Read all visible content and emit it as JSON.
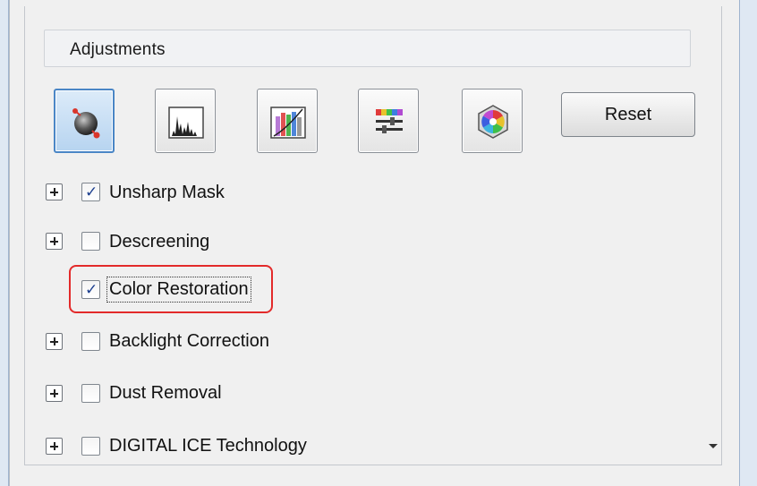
{
  "panel": {
    "title": "Adjustments"
  },
  "toolbar": {
    "buttons": [
      {
        "icon": "auto-exposure-icon",
        "active": true
      },
      {
        "icon": "histogram-icon",
        "active": false
      },
      {
        "icon": "tone-curve-icon",
        "active": false
      },
      {
        "icon": "color-balance-icon",
        "active": false
      },
      {
        "icon": "color-palette-icon",
        "active": false
      }
    ],
    "reset_label": "Reset"
  },
  "options": [
    {
      "label": "Unsharp Mask",
      "checked": true,
      "expandable": true
    },
    {
      "label": "Descreening",
      "checked": false,
      "expandable": true
    },
    {
      "label": "Color Restoration",
      "checked": true,
      "expandable": false,
      "highlighted": true
    },
    {
      "label": "Backlight Correction",
      "checked": false,
      "expandable": true
    },
    {
      "label": "Dust Removal",
      "checked": false,
      "expandable": true
    },
    {
      "label": "DIGITAL ICE Technology",
      "checked": false,
      "expandable": true
    }
  ],
  "colors": {
    "highlight": "#e32a2a",
    "active_button": "#4a86c6",
    "check": "#1c3f8f"
  }
}
